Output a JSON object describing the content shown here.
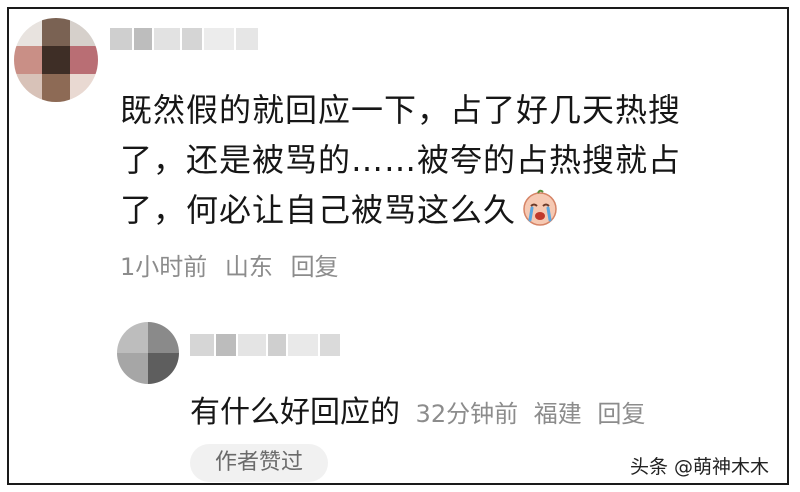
{
  "comment": {
    "line1": "既然假的就回应一下，占了好几天热搜",
    "line2": "了，还是被骂的……被夸的占热搜就占",
    "line3": "了，何必让自己被骂这么久",
    "emoji": "crying-face-emoji",
    "time": "1小时前",
    "location": "山东",
    "reply_label": "回复"
  },
  "reply": {
    "text": "有什么好回应的",
    "time": "32分钟前",
    "location": "福建",
    "reply_label": "回复",
    "liked_badge": "作者赞过"
  },
  "watermark": "头条 @萌神木木"
}
